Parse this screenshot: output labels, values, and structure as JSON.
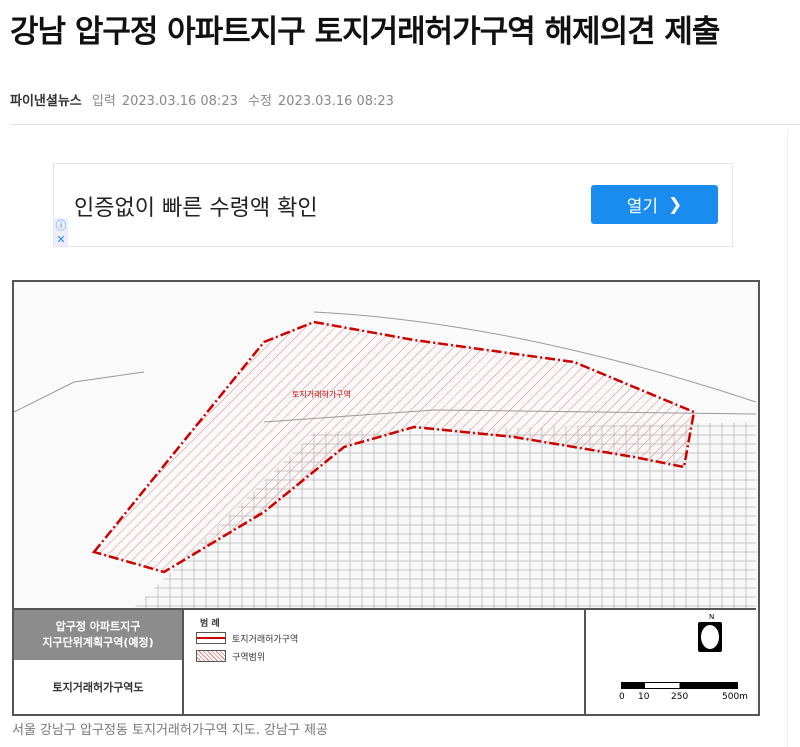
{
  "article": {
    "title": "강남 압구정 아파트지구 토지거래허가구역 해제의견 제출",
    "source": "파이낸셜뉴스",
    "input_label": "입력",
    "input_time": "2023.03.16 08:23",
    "edit_label": "수정",
    "edit_time": "2023.03.16 08:23"
  },
  "ad": {
    "text": "인증없이 빠른 수령액 확인",
    "button": "열기",
    "info_icon": "ⓘ",
    "close_icon": "✕"
  },
  "map": {
    "zone_label": "토지거래허가구역",
    "title_line1": "압구정 아파트지구",
    "title_line2": "지구단위계획구역(예정)",
    "map_name": "토지거래허가구역도",
    "legend_title": "범 례",
    "legend_item1": "토지거래허가구역",
    "legend_item2": "구역범위",
    "north": "N",
    "scale_0": "0",
    "scale_10": "10",
    "scale_250": "250",
    "scale_500": "500m"
  },
  "caption": "서울 강남구 압구정동 토지거래허가구역 지도. 강남구 제공"
}
